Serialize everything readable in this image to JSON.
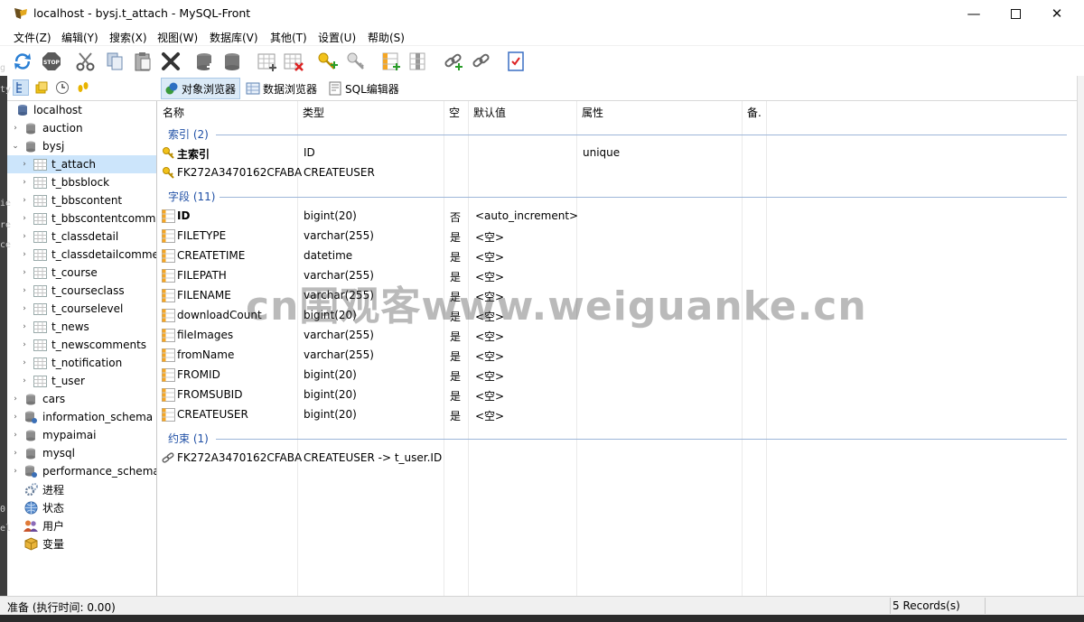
{
  "window": {
    "title": "localhost - bysj.t_attach - MySQL-Front"
  },
  "menu": [
    "文件(Z)",
    "编辑(Y)",
    "搜索(X)",
    "视图(W)",
    "数据库(V)",
    "其他(T)",
    "设置(U)",
    "帮助(S)"
  ],
  "nav": {
    "tabs": [
      "对象浏览器",
      "数据浏览器",
      "SQL编辑器"
    ],
    "active": "对象浏览器"
  },
  "tree": {
    "server": "localhost",
    "nodes": [
      "auction",
      "bysj",
      "t_attach",
      "t_bbsblock",
      "t_bbscontent",
      "t_bbscontentcomme",
      "t_classdetail",
      "t_classdetailcomme",
      "t_course",
      "t_courseclass",
      "t_courselevel",
      "t_news",
      "t_newscomments",
      "t_notification",
      "t_user",
      "cars",
      "information_schema",
      "mypaimai",
      "mysql",
      "performance_schema",
      "进程",
      "状态",
      "用户",
      "变量"
    ]
  },
  "columns": [
    "名称",
    "类型",
    "空",
    "默认值",
    "属性",
    "备."
  ],
  "groups": {
    "index": "索引 (2)",
    "fields": "字段 (11)",
    "constraints": "约束 (1)"
  },
  "indexes": [
    {
      "name": "主索引",
      "type": "ID",
      "attr": "unique"
    },
    {
      "name": "FK272A3470162CFABA",
      "type": "CREATEUSER",
      "attr": ""
    }
  ],
  "fields": [
    {
      "name": "ID",
      "type": "bigint(20)",
      "null": "否",
      "default": "<auto_increment>"
    },
    {
      "name": "FILETYPE",
      "type": "varchar(255)",
      "null": "是",
      "default": "<空>"
    },
    {
      "name": "CREATETIME",
      "type": "datetime",
      "null": "是",
      "default": "<空>"
    },
    {
      "name": "FILEPATH",
      "type": "varchar(255)",
      "null": "是",
      "default": "<空>"
    },
    {
      "name": "FILENAME",
      "type": "varchar(255)",
      "null": "是",
      "default": "<空>"
    },
    {
      "name": "downloadCount",
      "type": "bigint(20)",
      "null": "是",
      "default": "<空>"
    },
    {
      "name": "fileImages",
      "type": "varchar(255)",
      "null": "是",
      "default": "<空>"
    },
    {
      "name": "fromName",
      "type": "varchar(255)",
      "null": "是",
      "default": "<空>"
    },
    {
      "name": "FROMID",
      "type": "bigint(20)",
      "null": "是",
      "default": "<空>"
    },
    {
      "name": "FROMSUBID",
      "type": "bigint(20)",
      "null": "是",
      "default": "<空>"
    },
    {
      "name": "CREATEUSER",
      "type": "bigint(20)",
      "null": "是",
      "default": "<空>"
    }
  ],
  "constraints": [
    {
      "name": "FK272A3470162CFABA",
      "type": "CREATEUSER -> t_user.ID"
    }
  ],
  "status": {
    "left": "准备  (执行时间: 0.00)",
    "right": "5 Records(s)"
  },
  "watermark": "cn围观客www.weiguanke.cn",
  "left_strip": [
    "g",
    "ty",
    "ie",
    "re",
    "ce",
    "0",
    "el"
  ]
}
